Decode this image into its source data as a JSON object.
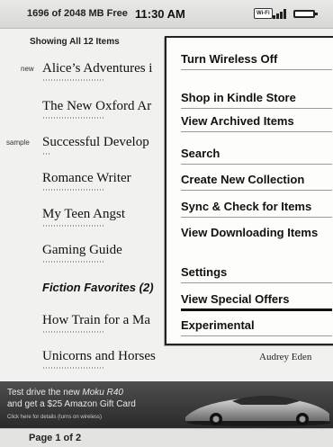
{
  "status": {
    "storage": "1696 of 2048 MB Free",
    "time": "11:30 AM",
    "wifi_badge": "Wi-Fi"
  },
  "list": {
    "showing": "Showing All 12 Items",
    "items": [
      {
        "badge": "new",
        "title": "Alice’s Adventures i",
        "author": ""
      },
      {
        "badge": "",
        "title": "The New Oxford Ar",
        "author": ""
      },
      {
        "badge": "sample",
        "title": "Successful Develop",
        "author": ""
      },
      {
        "badge": "",
        "title": "Romance Writer",
        "author": ""
      },
      {
        "badge": "",
        "title": "My Teen Angst",
        "author": ""
      },
      {
        "badge": "",
        "title": "Gaming Guide",
        "author": ""
      },
      {
        "badge": "",
        "title": "Fiction Favorites (2)",
        "author": ""
      },
      {
        "badge": "",
        "title": "How Train for a Ma",
        "author": ""
      },
      {
        "badge": "",
        "title": "Unicorns and Horses",
        "author": "Audrey Eden"
      }
    ]
  },
  "menu": {
    "items": [
      "Turn Wireless Off",
      "Shop in Kindle Store",
      "View Archived Items",
      "Search",
      "Create New Collection",
      "Sync & Check for Items",
      "View Downloading Items",
      "Settings",
      "View Special Offers",
      "Experimental"
    ],
    "selected": "View Special Offers"
  },
  "ad": {
    "line1_prefix": "Test drive the new ",
    "line1_product": "Moku R40",
    "line2": "and get a $25 Amazon Gift Card",
    "line3": "Click here for details (turns on wireless)"
  },
  "footer": {
    "page": "Page 1 of 2"
  }
}
